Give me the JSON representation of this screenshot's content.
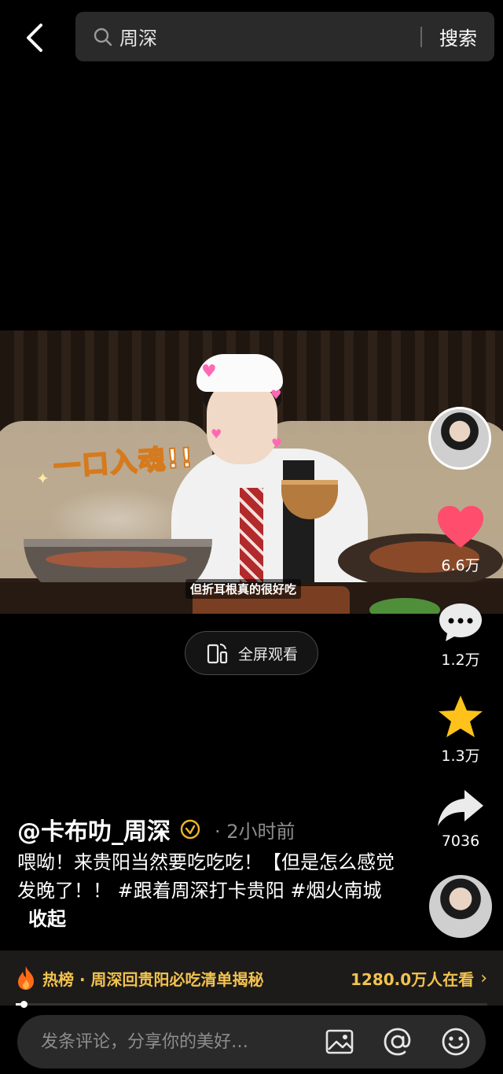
{
  "search": {
    "value": "周深",
    "button_label": "搜索"
  },
  "video": {
    "caption_overlay": "一口入魂!!",
    "subtitle": "但折耳根真的很好吃",
    "fullscreen_label": "全屏观看"
  },
  "actions": {
    "likes": "6.6万",
    "comments": "1.2万",
    "favorites": "1.3万",
    "shares": "7036",
    "like_color": "#ff4d6d",
    "favorite_color": "#ffc21a"
  },
  "post": {
    "author": "@卡布叻_周深",
    "time": "· 2小时前",
    "description": "喂呦！来贵阳当然要吃吃吃！【但是怎么感觉发晚了！！ #跟着周深打卡贵阳 #烟火南城",
    "collapse_label": "收起"
  },
  "hot": {
    "title": "热榜 · 周深回贵阳必吃清单揭秘",
    "viewers": "1280.0万人在看",
    "accent": "#f3c24e"
  },
  "progress": 0.01,
  "comment": {
    "placeholder": "发条评论，分享你的美好…"
  }
}
